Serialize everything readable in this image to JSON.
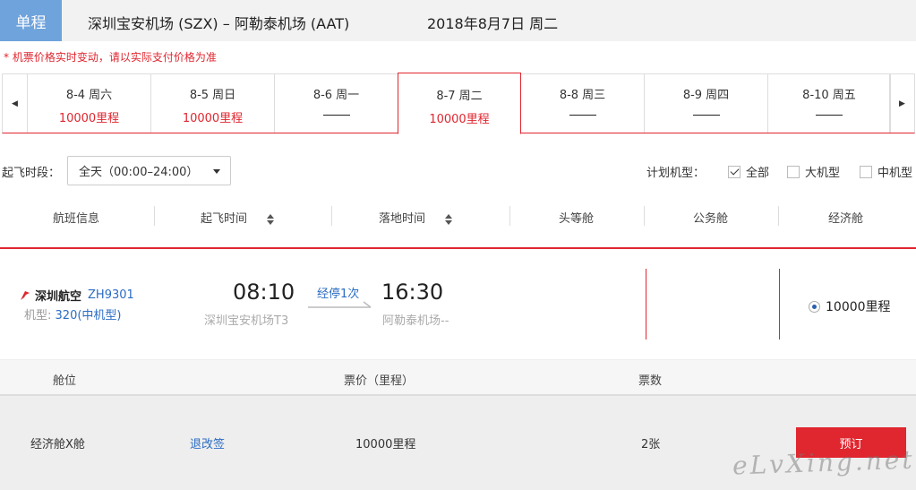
{
  "header": {
    "trip_type": "单程",
    "route": "深圳宝安机场 (SZX) – 阿勒泰机场 (AAT)",
    "date": "2018年8月7日 周二"
  },
  "notice": "* 机票价格实时变动，请以实际支付价格为准",
  "dates": [
    {
      "label": "8-4 周六",
      "price": "10000里程"
    },
    {
      "label": "8-5 周日",
      "price": "10000里程"
    },
    {
      "label": "8-6 周一",
      "price": ""
    },
    {
      "label": "8-7 周二",
      "price": "10000里程"
    },
    {
      "label": "8-8 周三",
      "price": ""
    },
    {
      "label": "8-9 周四",
      "price": ""
    },
    {
      "label": "8-10 周五",
      "price": ""
    }
  ],
  "selected_date_index": 3,
  "filters": {
    "time_label": "起飞时段：",
    "time_value": "全天（00:00–24:00）",
    "plane_label": "计划机型：",
    "plane_options": [
      {
        "label": "全部",
        "checked": true
      },
      {
        "label": "大机型",
        "checked": false
      },
      {
        "label": "中机型",
        "checked": false
      }
    ]
  },
  "columns": {
    "flight_info": "航班信息",
    "departure": "起飞时间",
    "arrival": "落地时间",
    "first": "头等舱",
    "business": "公务舱",
    "economy": "经济舱"
  },
  "flight": {
    "airline": "深圳航空",
    "flight_no": "ZH9301",
    "aircraft_label": "机型:",
    "aircraft_type": "320(中机型)",
    "dep_time": "08:10",
    "dep_airport": "深圳宝安机场T3",
    "stop": "经停1次",
    "arr_time": "16:30",
    "arr_airport": "阿勒泰机场--",
    "economy_price": "10000里程"
  },
  "cabin_table": {
    "headers": {
      "cabin": "舱位",
      "price": "票价（里程）",
      "tickets": "票数"
    },
    "row": {
      "cabin": "经济舱X舱",
      "refund": "退改签",
      "price": "10000里程",
      "tickets": "2张",
      "book": "预订"
    }
  },
  "watermark": "eLvXing.net",
  "colors": {
    "accent": "#e0262f",
    "badge": "#6fa3dc",
    "link": "#2b6cc4"
  }
}
